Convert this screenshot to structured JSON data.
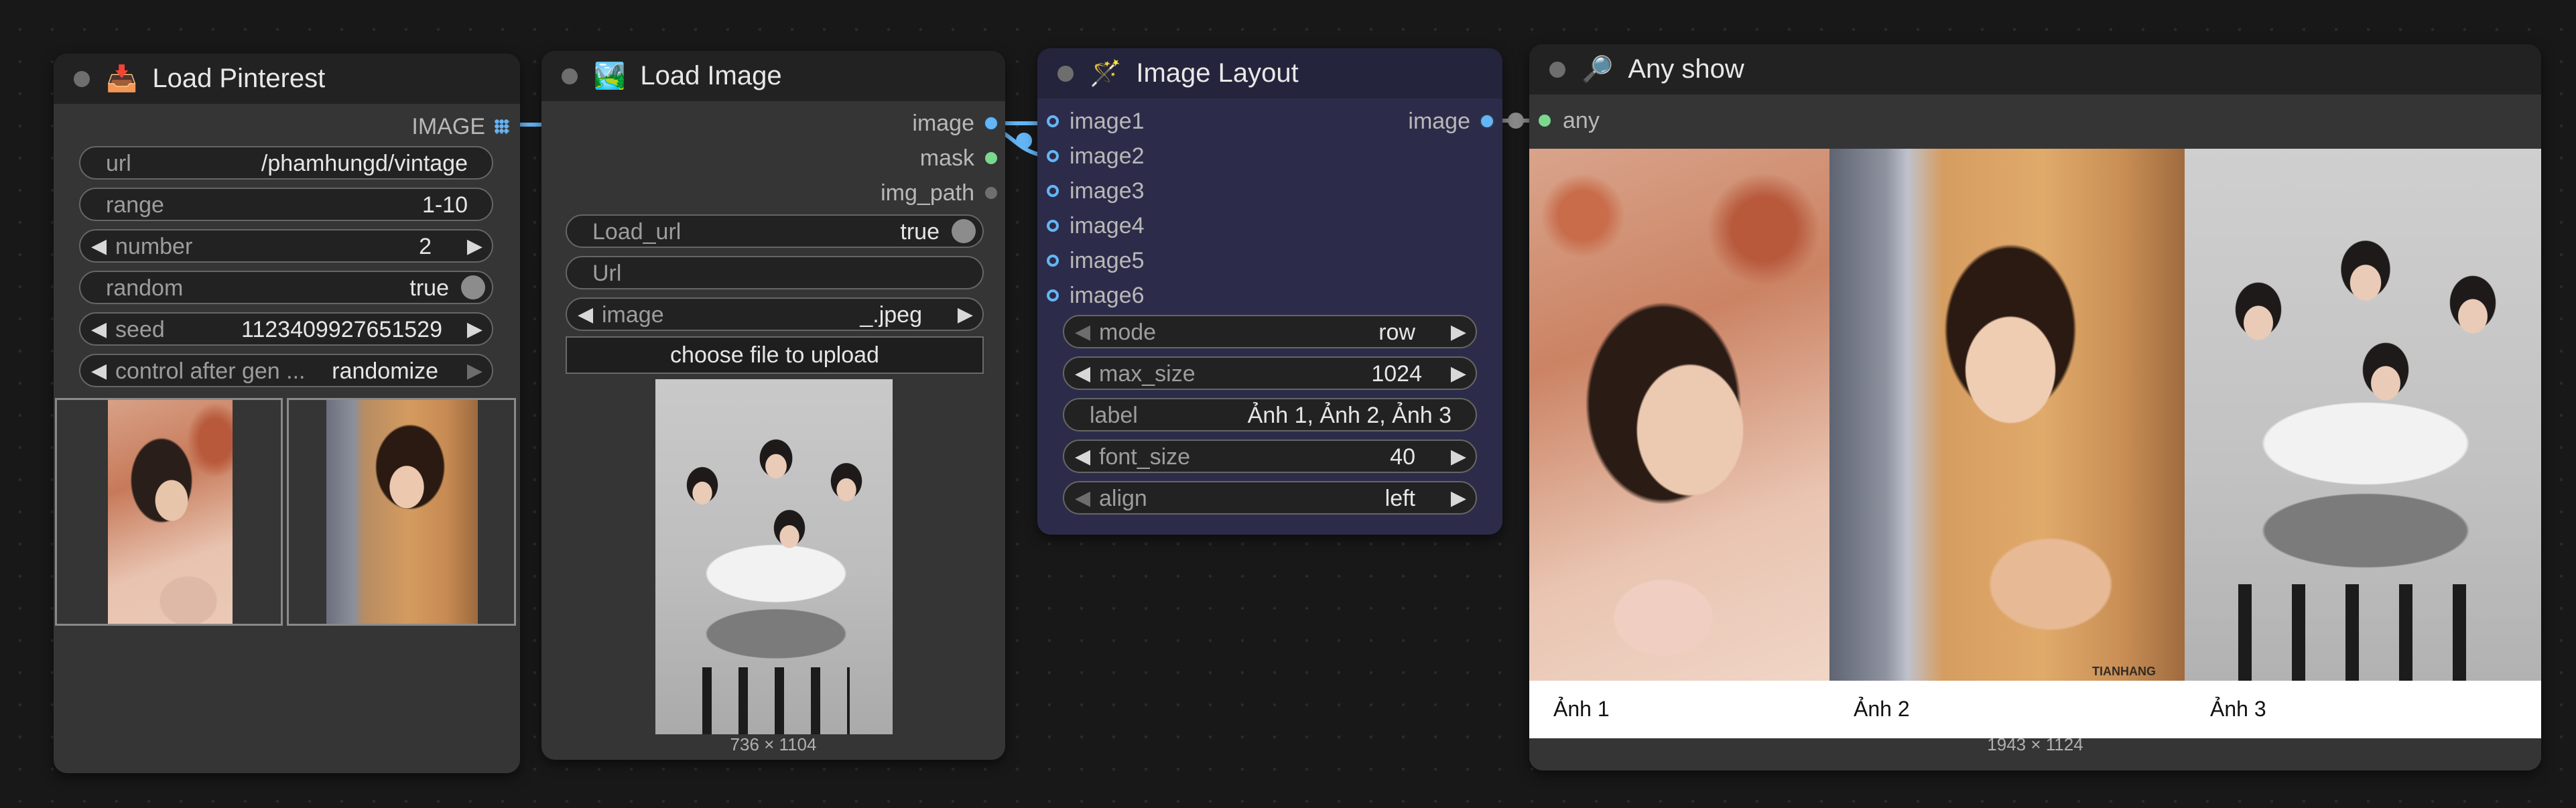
{
  "links": {
    "color": "#64b5f6"
  },
  "nodes": {
    "load_pinterest": {
      "icon": "inbox-tray-icon",
      "title": "Load Pinterest",
      "output": "IMAGE",
      "widgets": {
        "url": {
          "name": "url",
          "value": "/phamhungd/vintage"
        },
        "range": {
          "name": "range",
          "value": "1-10"
        },
        "number": {
          "name": "number",
          "value": "2"
        },
        "random": {
          "name": "random",
          "value": "true"
        },
        "seed": {
          "name": "seed",
          "value": "1123409927651529"
        },
        "control": {
          "name": "control after gen ...",
          "value": "randomize"
        }
      }
    },
    "load_image": {
      "icon": "framed-picture-icon",
      "title": "Load Image",
      "outputs": [
        "image",
        "mask",
        "img_path"
      ],
      "widgets": {
        "load_url": {
          "name": "Load_url",
          "value": "true"
        },
        "url": {
          "name": "Url"
        },
        "image": {
          "name": "image",
          "value": "_.jpeg"
        }
      },
      "upload_label": "choose file to upload",
      "size_caption": "736 × 1104"
    },
    "image_layout": {
      "icon": "magic-wand-icon",
      "title": "Image Layout",
      "inputs": [
        "image1",
        "image2",
        "image3",
        "image4",
        "image5",
        "image6"
      ],
      "output": "image",
      "bg_color": "#2c2c4a",
      "widgets": {
        "mode": {
          "name": "mode",
          "value": "row"
        },
        "max_size": {
          "name": "max_size",
          "value": "1024"
        },
        "label": {
          "name": "label",
          "value": "Ảnh 1, Ảnh 2, Ảnh 3"
        },
        "font_size": {
          "name": "font_size",
          "value": "40"
        },
        "align": {
          "name": "align",
          "value": "left"
        }
      }
    },
    "any_show": {
      "icon": "magnifier-icon",
      "title": "Any show",
      "input": "any",
      "captions": [
        "Ảnh 1",
        "Ảnh 2",
        "Ảnh 3"
      ],
      "watermarks": [
        "TIANHANG"
      ],
      "size_caption": "1943 × 1124"
    }
  }
}
